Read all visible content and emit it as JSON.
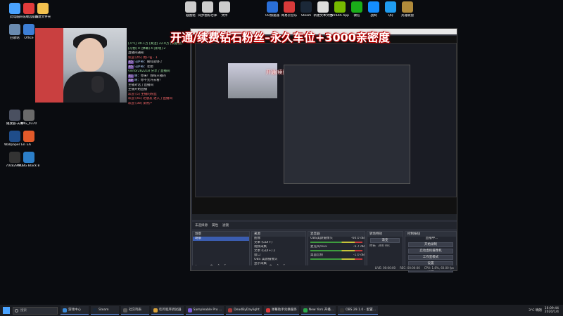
{
  "desktop_left_icons": [
    {
      "label": "此电脑",
      "color": "#4aa3ff"
    },
    {
      "label": "同花顺远航版",
      "color": "#e23b3b"
    },
    {
      "label": "新建文件夹",
      "color": "#f2c14e"
    },
    {
      "label": "回收站",
      "color": "#6a8bb0"
    },
    {
      "label": "Office",
      "color": "#3d7fd6"
    },
    {
      "label": "播放器-天赐",
      "color": "#4a5060"
    },
    {
      "label": "IMG_0370",
      "color": "#6a6a6a"
    },
    {
      "label": "Wallpaper Engine",
      "color": "#1f4d8a"
    },
    {
      "label": "EA",
      "color": "#e25a2a"
    },
    {
      "label": "70c829f0...",
      "color": "#333"
    },
    {
      "label": "PUBG Black Budget Pl...",
      "color": "#2c7fc9"
    }
  ],
  "desktop_top_icons": [
    {
      "label": "截图组",
      "color": "#ccc"
    },
    {
      "label": "同步图标仓库",
      "color": "#ccc"
    },
    {
      "label": "文件",
      "color": "#ccc"
    },
    {
      "label": "UU加速器",
      "color": "#2a6fd8"
    },
    {
      "label": "网易云音乐",
      "color": "#d83a3a"
    },
    {
      "label": "Steam",
      "color": "#1b2838"
    },
    {
      "label": "新建文本文档",
      "color": "#ddd"
    },
    {
      "label": "NVIDIA App",
      "color": "#76b900"
    },
    {
      "label": "微信",
      "color": "#1aad19"
    },
    {
      "label": "战网",
      "color": "#148eff"
    },
    {
      "label": "QQ",
      "color": "#1f9cf0"
    },
    {
      "label": "英雄联盟",
      "color": "#b08a3a"
    }
  ],
  "banner": "开通/续费钻石粉丝–永久车位+3000亲密度",
  "banner_inner": "开通/续费钻石粉丝–永久车位+3000亲密度",
  "chat": {
    "header": "[人气] 40.1万 [关注] 22.0万 [贡献榜]",
    "stats": "[礼物] 0 [弹幕] 4 [新增] 2",
    "rows": [
      {
        "text": "直播间通知",
        "kind": "sys"
      },
      {
        "text": "欢迎 [45] 用户名 · 1",
        "kind": "hl"
      },
      {
        "lv": "45",
        "name": "乌萨奇：",
        "msg": "眼科就够了"
      },
      {
        "lv": "45",
        "name": "乌萨奇：",
        "msg": "老想"
      },
      {
        "text": "visitor282218 分享了直播间",
        "kind": "bar"
      },
      {
        "lv": "41",
        "name": "晴：",
        "msg": "你来！我每只播的"
      },
      {
        "lv": "40",
        "name": "晴：",
        "msg": "你不允许去看！"
      },
      {
        "text": "主播对话了直播间",
        "kind": "sys"
      },
      {
        "text": "主播开始直播",
        "kind": "sys"
      },
      {
        "text": "欢迎 [5] 主播的粉丝",
        "kind": "hl"
      },
      {
        "text": "欢迎 [45] 老朋友 进入了直播间",
        "kind": "hl"
      },
      {
        "text": "欢迎 [38] 某用户",
        "kind": "hl"
      }
    ]
  },
  "obs": {
    "toolbar": [
      "未选择源",
      "属性",
      "滤镜"
    ],
    "scenes": {
      "title": "场景",
      "items": [
        "场景"
      ]
    },
    "sources": {
      "title": "来源",
      "items": [
        "图像",
        "文本 (GDI+)",
        "视频采集",
        "文本 (GDI+) 2",
        "窗口",
        "OBS 美颜摄像头",
        "显示采集"
      ]
    },
    "mixer": {
      "title": "混音器",
      "channels": [
        "OBS美颜摄像头",
        "麦克风/Aux",
        "桌面音频"
      ],
      "values": [
        "-60.0 dB",
        "-5.7 dB",
        "-1.0 dB"
      ]
    },
    "transitions": {
      "title": "转场特效",
      "type": "渐变",
      "duration_label": "时长",
      "duration": "300 ms"
    },
    "controls": {
      "title": "控制按钮",
      "buttons": [
        "开始录制",
        "启动虚拟摄像机",
        "工作室模式",
        "设置",
        "退出"
      ],
      "status": "直播中..."
    },
    "status": [
      "LIVE: 00:00:00",
      "REC: 00:00:00",
      "CPU: 1.8%, 60.00 fps"
    ]
  },
  "taskbar": {
    "search_placeholder": "搜索",
    "apps": [
      {
        "label": "游戏中心",
        "color": "#3a8ad8"
      },
      {
        "label": "Steam",
        "color": "#1b2838"
      },
      {
        "label": "社交列表",
        "color": "#5a5a5a"
      },
      {
        "label": "吃鸡程序调试器",
        "color": "#d8a23a"
      },
      {
        "label": "Sampleable Pro ...",
        "color": "#7c5cd8"
      },
      {
        "label": "DeadByDaylight",
        "color": "#a83a3a"
      },
      {
        "label": "弹幕助手兑换服务",
        "color": "#d83a3a"
      },
      {
        "label": "New York 开播...",
        "color": "#2aa84a"
      },
      {
        "label": "OBS 29.1.0 - 配置...",
        "color": "#333"
      }
    ],
    "weather": "3°C 晴朗",
    "time": "16:09:44",
    "date": "2020/1/4"
  }
}
